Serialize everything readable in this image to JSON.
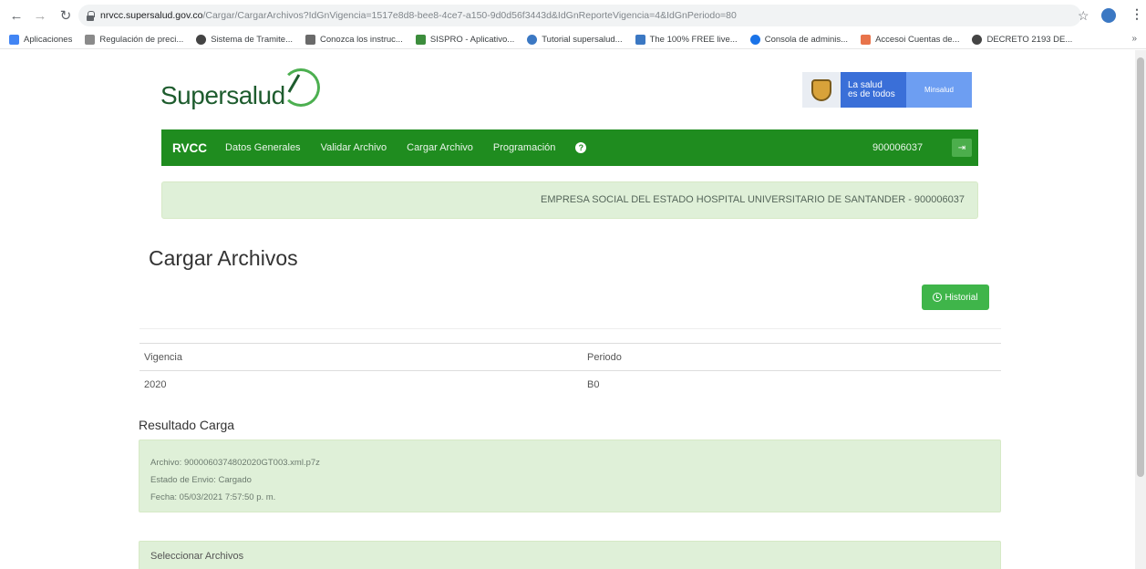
{
  "browser": {
    "url_host": "nrvcc.supersalud.gov.co",
    "url_path": "/Cargar/CargarArchivos?IdGnVigencia=1517e8d8-bee8-4ce7-a150-9d0d56f3443d&IdGnReporteVigencia=4&IdGnPeriodo=80",
    "bookmarks": [
      {
        "label": "Aplicaciones",
        "color": "#4285f4"
      },
      {
        "label": "Regulación de preci...",
        "color": "#8a8a8a"
      },
      {
        "label": "Sistema de Tramite...",
        "color": "#444444"
      },
      {
        "label": "Conozca los instruc...",
        "color": "#6a6a6a"
      },
      {
        "label": "SISPRO - Aplicativo...",
        "color": "#3c8d3c"
      },
      {
        "label": "Tutorial supersalud...",
        "color": "#3b78c3"
      },
      {
        "label": "The 100% FREE live...",
        "color": "#3b78c3"
      },
      {
        "label": "Consola de adminis...",
        "color": "#1a73e8"
      },
      {
        "label": "Accesoi Cuentas de...",
        "color": "#e8734a"
      },
      {
        "label": "DECRETO 2193 DE...",
        "color": "#444444"
      }
    ],
    "bookmarks_more": "»"
  },
  "header": {
    "logo_text": "Supersalud",
    "gov_line1": "La salud",
    "gov_line2": "es de todos",
    "gov_ministry": "Minsalud"
  },
  "navbar": {
    "brand": "RVCC",
    "items": [
      "Datos Generales",
      "Validar Archivo",
      "Cargar Archivo",
      "Programación"
    ],
    "help": "?",
    "nit": "900006037",
    "accent": "#1f8c1f"
  },
  "entity": "EMPRESA SOCIAL DEL ESTADO HOSPITAL UNIVERSITARIO DE SANTANDER - 900006037",
  "page": {
    "title": "Cargar Archivos",
    "historial_label": "Historial"
  },
  "table": {
    "headers": [
      "Vigencia",
      "Periodo"
    ],
    "row": [
      "2020",
      "B0"
    ]
  },
  "result": {
    "title": "Resultado Carga",
    "archivo": "Archivo: 900006037480202​0GT003.xml.p7z",
    "estado": "Estado de Envio: Cargado",
    "fecha": "Fecha: 05/03/2021 7:57:50 p. m."
  },
  "select": {
    "title": "Seleccionar Archivos"
  }
}
